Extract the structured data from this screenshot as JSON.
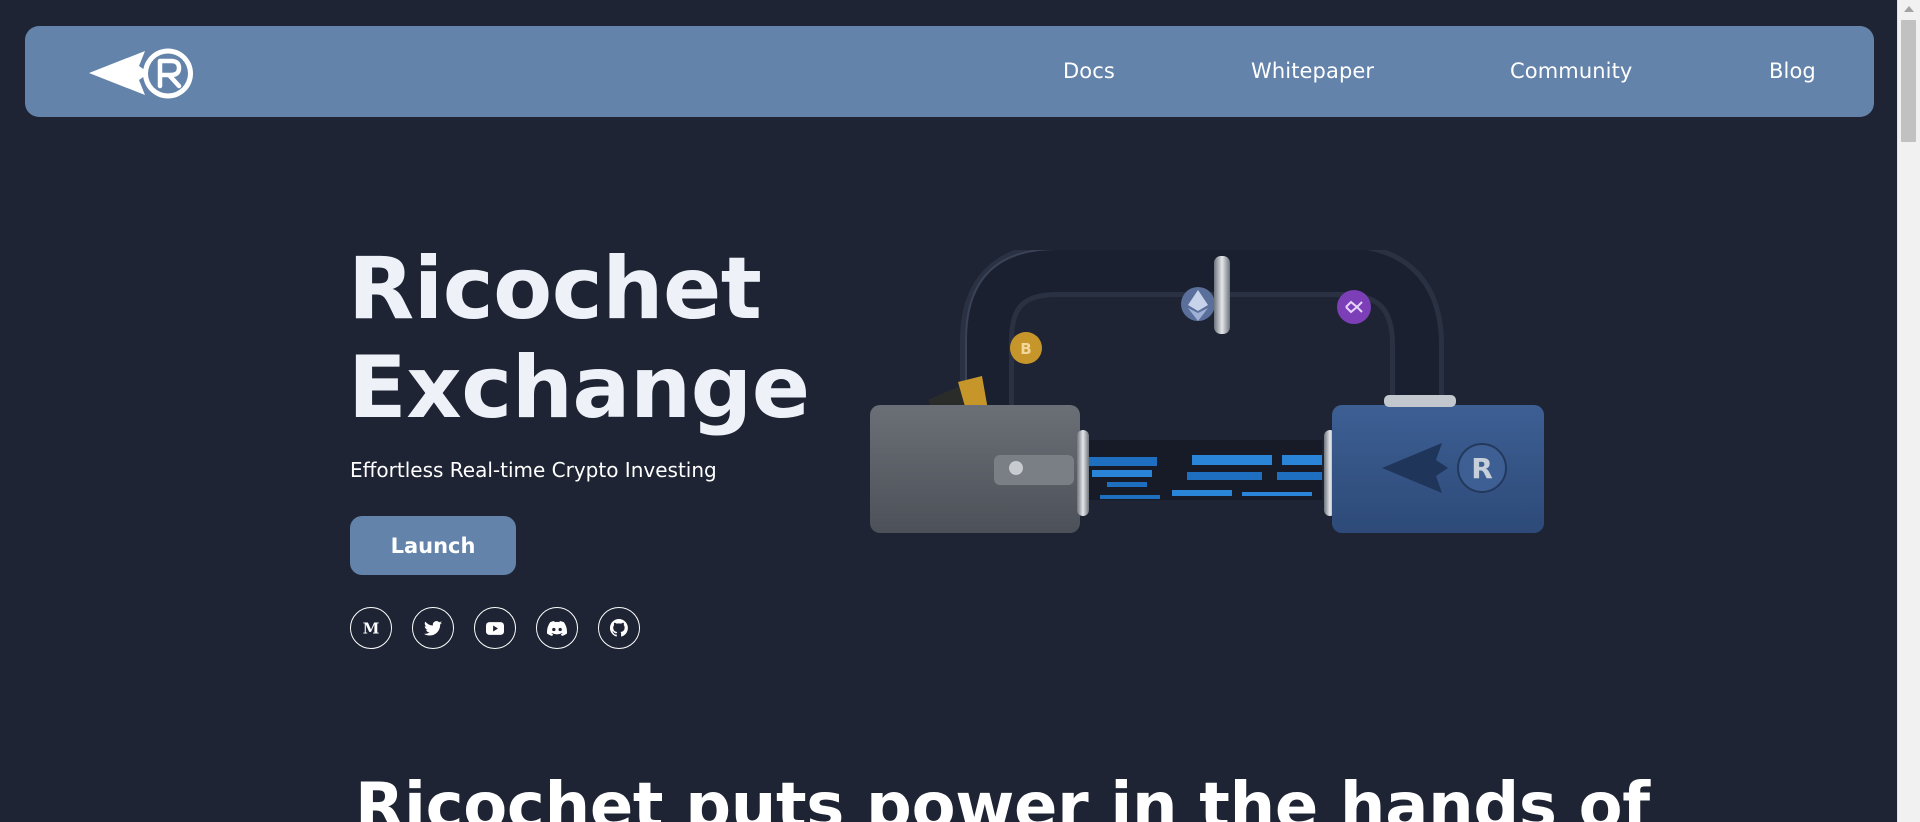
{
  "nav": {
    "logo_name": "ricochet-logo",
    "links": [
      "Docs",
      "Whitepaper",
      "Community",
      "Blog"
    ]
  },
  "hero": {
    "title_line1": "Ricochet",
    "title_line2": "Exchange",
    "subtitle": "Effortless Real-time Crypto Investing",
    "launch_label": "Launch",
    "socials": [
      {
        "icon": "medium-icon"
      },
      {
        "icon": "twitter-icon"
      },
      {
        "icon": "youtube-icon"
      },
      {
        "icon": "discord-icon"
      },
      {
        "icon": "github-icon"
      }
    ],
    "illustration_coins": [
      "bitcoin",
      "ethereum",
      "polygon"
    ]
  },
  "section": {
    "heading": "Ricochet puts power in the hands of"
  },
  "colors": {
    "background": "#1e2433",
    "accent": "#6383ab",
    "text": "#ffffff"
  }
}
